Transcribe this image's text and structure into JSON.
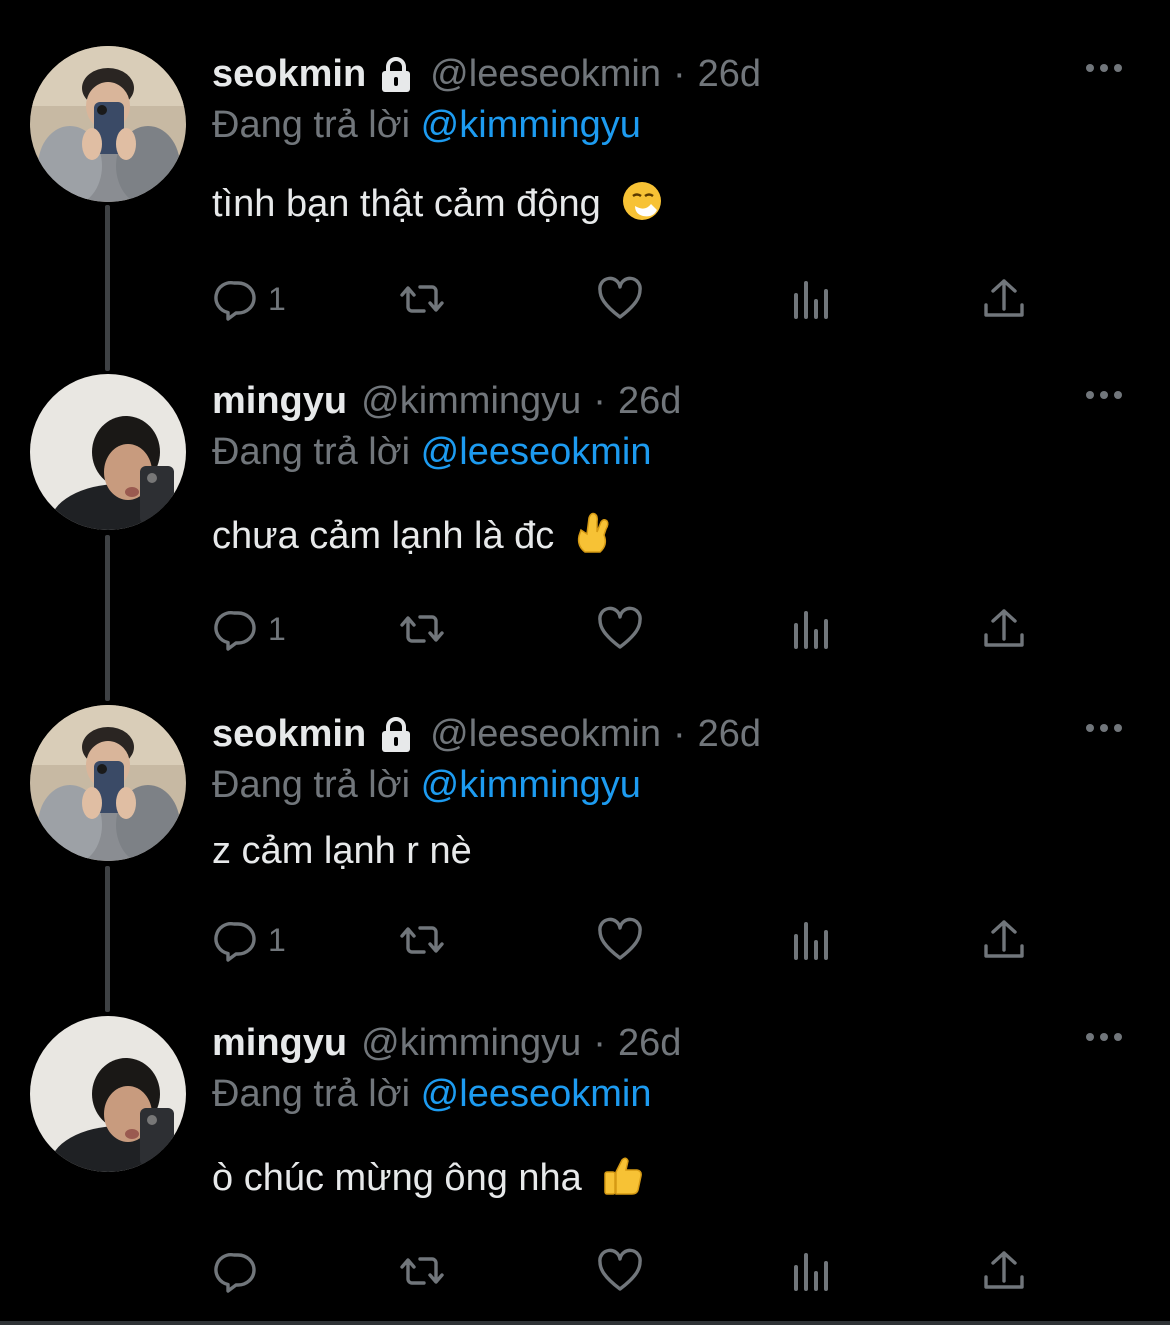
{
  "tweets": [
    {
      "name": "seokmin",
      "locked": true,
      "handle": "@leeseokmin",
      "dot": "·",
      "time": "26d",
      "reply_prefix": "Đang trả lời",
      "reply_to": "@kimmingyu",
      "text": "tình bạn thật cảm động",
      "emoji": "sneezing-face-emoji",
      "reply_count": "1"
    },
    {
      "name": "mingyu",
      "locked": false,
      "handle": "@kimmingyu",
      "dot": "·",
      "time": "26d",
      "reply_prefix": "Đang trả lời",
      "reply_to": "@leeseokmin",
      "text": "chưa cảm lạnh là đc",
      "emoji": "crossed-fingers-emoji",
      "reply_count": "1"
    },
    {
      "name": "seokmin",
      "locked": true,
      "handle": "@leeseokmin",
      "dot": "·",
      "time": "26d",
      "reply_prefix": "Đang trả lời",
      "reply_to": "@kimmingyu",
      "text": "z cảm lạnh r nè",
      "emoji": "",
      "reply_count": "1"
    },
    {
      "name": "mingyu",
      "locked": false,
      "handle": "@kimmingyu",
      "dot": "·",
      "time": "26d",
      "reply_prefix": "Đang trả lời",
      "reply_to": "@leeseokmin",
      "text": "ò chúc mừng ông nha",
      "emoji": "thumbs-up-emoji",
      "reply_count": ""
    }
  ],
  "action_icons": [
    "reply-icon",
    "retweet-icon",
    "like-icon",
    "analytics-icon",
    "share-icon"
  ],
  "colors": {
    "background": "#000000",
    "text": "#e7e9ea",
    "muted": "#71767b",
    "link": "#1d9bf0",
    "thread_line": "#3e4144"
  }
}
